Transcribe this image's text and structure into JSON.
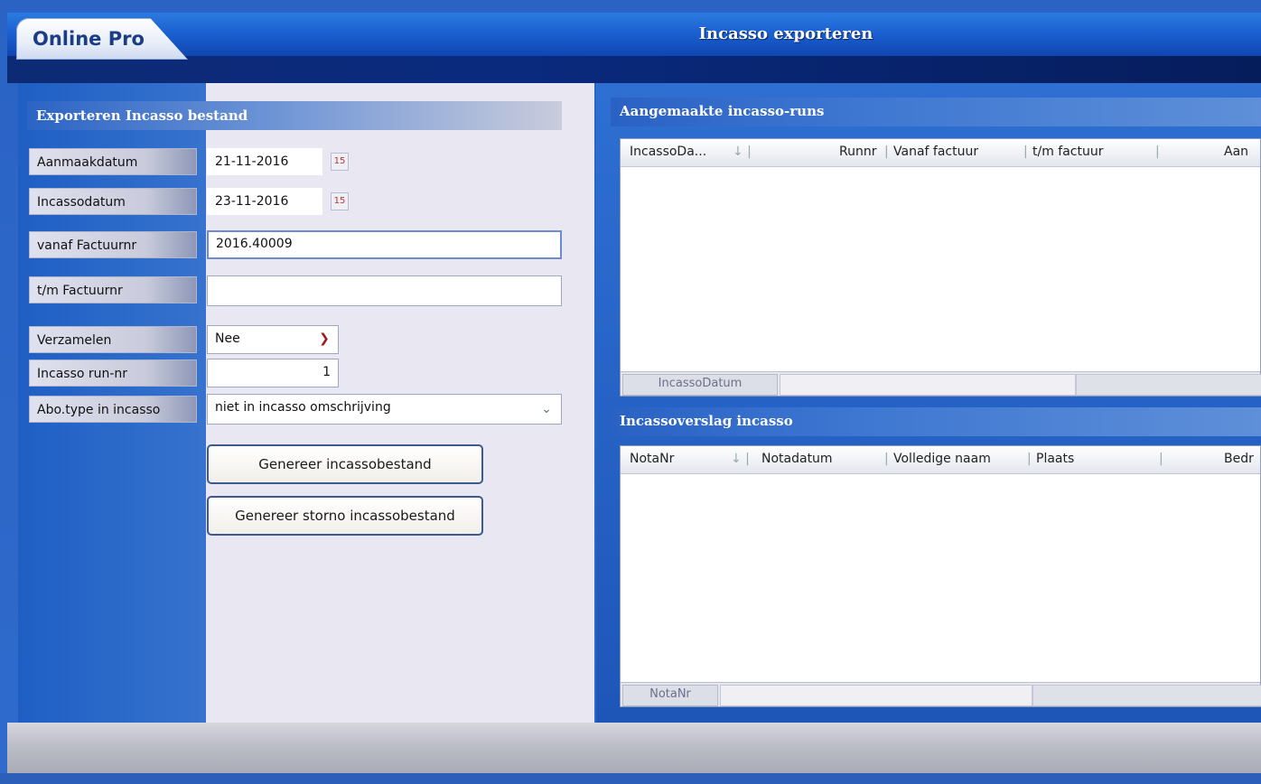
{
  "app": {
    "brand": "Online Pro",
    "window_title": "Incasso exporteren"
  },
  "left": {
    "section_title": "Exporteren Incasso bestand",
    "fields": {
      "aanmaakdatum": {
        "label": "Aanmaakdatum",
        "value": "21-11-2016"
      },
      "incassodatum": {
        "label": "Incassodatum",
        "value": "23-11-2016"
      },
      "vanaf_factuurnr": {
        "label": "vanaf Factuurnr",
        "value": "2016.40009"
      },
      "tm_factuurnr": {
        "label": "t/m  Factuurnr",
        "value": ""
      },
      "verzamelen": {
        "label": "Verzamelen",
        "value": "Nee"
      },
      "run_nr": {
        "label": "Incasso run-nr",
        "value": "1"
      },
      "abo_type": {
        "label": "Abo.type in incasso",
        "value": "niet in incasso omschrijving"
      }
    },
    "buttons": {
      "genereer": "Genereer incassobestand",
      "genereer_storno": "Genereer storno incassobestand"
    }
  },
  "right": {
    "runs": {
      "title": "Aangemaakte incasso-runs",
      "columns": [
        "IncassoDa...",
        "Runnr",
        "Vanaf factuur",
        "t/m factuur",
        "Aan"
      ],
      "footer_group": "IncassoDatum"
    },
    "verslag": {
      "title": "Incassoverslag incasso",
      "columns": [
        "NotaNr",
        "Notadatum",
        "Volledige naam",
        "Plaats",
        "Bedr"
      ],
      "footer_group": "NotaNr"
    }
  },
  "colors": {
    "header_blue": "#1a5fd0",
    "panel_blue": "#2f6fd2",
    "accent_dark": "#0a2f86"
  }
}
